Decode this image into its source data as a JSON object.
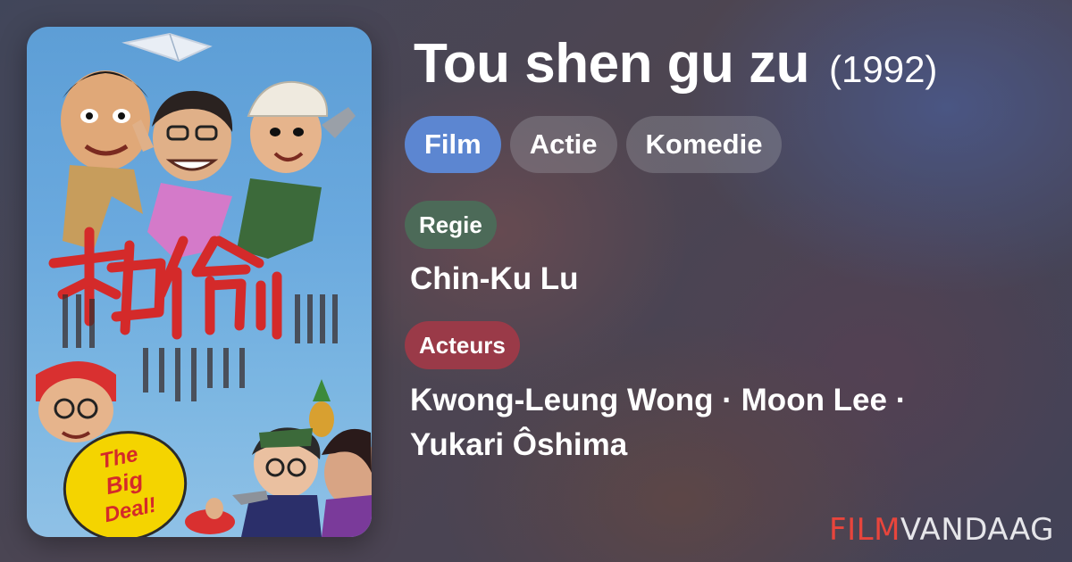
{
  "movie": {
    "title": "Tou shen gu zu",
    "year": "(1992)"
  },
  "genres": [
    "Film",
    "Actie",
    "Komedie"
  ],
  "directors": {
    "label": "Regie",
    "names": "Chin-Ku Lu"
  },
  "cast": {
    "label": "Acteurs",
    "names": [
      "Kwong-Leung Wong",
      "Moon Lee",
      "Yukari Ôshima"
    ],
    "separator": " · "
  },
  "brand": {
    "part1": "FILM",
    "part2": "VANDAAG"
  },
  "poster": {
    "title_cn": "神偷",
    "tagline_lines": [
      "The",
      "Big",
      "Deal!"
    ]
  },
  "colors": {
    "genre_primary": "#5c86d1",
    "regie_badge": "#4c6a58",
    "acteurs_badge": "#9a3a48",
    "brand_red": "#e8453c"
  }
}
